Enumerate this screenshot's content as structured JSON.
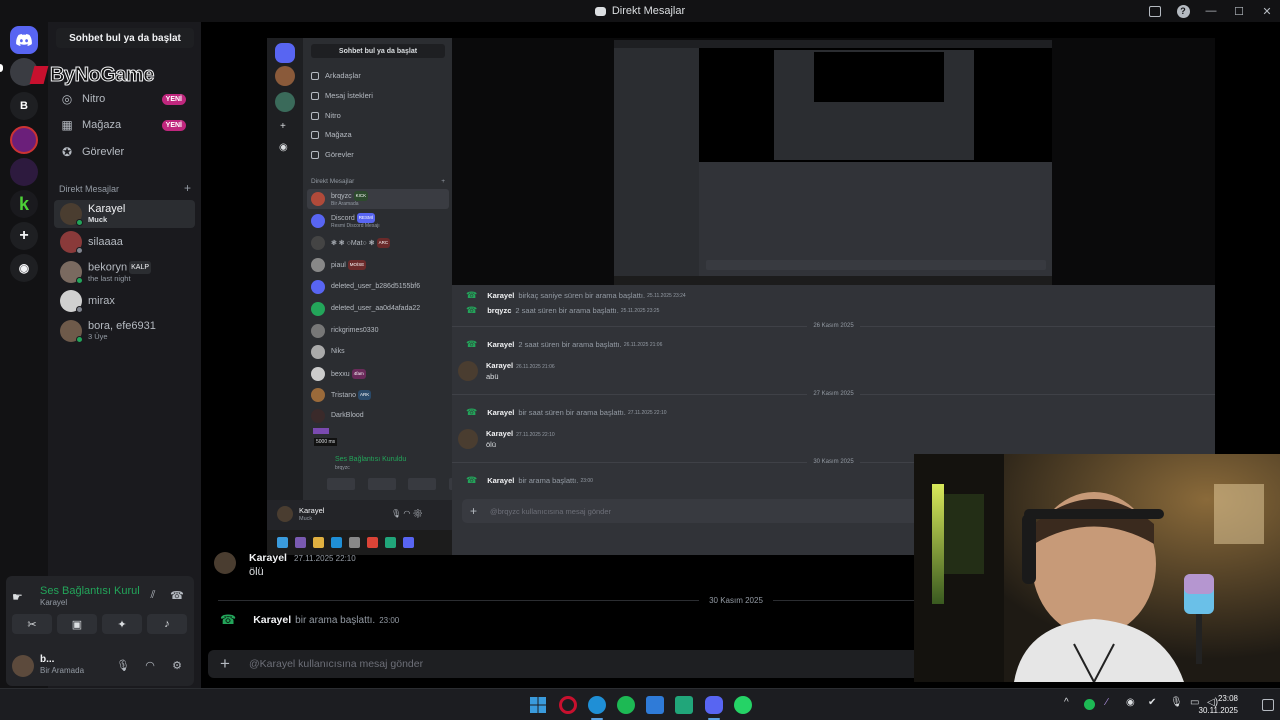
{
  "window": {
    "title": "Direkt Mesajlar"
  },
  "rail": {
    "servers": [
      {
        "name": "discord-home",
        "letter": "",
        "color": "#5865f2"
      },
      {
        "name": "server-b",
        "letter": "B",
        "color": "#2b2d31"
      }
    ]
  },
  "overlay_text": "ByNoGame",
  "sidebar": {
    "search_label": "Sohbet bul ya da başlat",
    "nav": [
      {
        "label": "Nitro",
        "badge": "YENİ"
      },
      {
        "label": "Mağaza",
        "badge": "YENİ"
      },
      {
        "label": "Görevler",
        "badge": ""
      }
    ],
    "dm_header": "Direkt Mesajlar",
    "dm_add": "+",
    "dms": [
      {
        "name": "Karayel",
        "sub": "Muck"
      },
      {
        "name": "silaaaa",
        "sub": ""
      },
      {
        "name": "bekoryn",
        "tag": "KALP",
        "sub": "the last night"
      },
      {
        "name": "mirax",
        "sub": ""
      },
      {
        "name": "bora, efe6931",
        "sub": "3 Üye"
      }
    ]
  },
  "voice": {
    "status": "Ses Bağlantısı Kuruldu",
    "channel": "Karayel",
    "user_name": "b...",
    "user_status": "Bir Aramada"
  },
  "stream": {
    "search_label": "Sohbet bul ya da başlat",
    "nav": [
      "Arkadaşlar",
      "Mesaj İstekleri",
      "Nitro",
      "Mağaza",
      "Görevler"
    ],
    "dm_header": "Direkt Mesajlar",
    "dms": [
      {
        "name": "brqyzc",
        "tag": "KICK",
        "sub": "Bir Aramada"
      },
      {
        "name": "Discord",
        "tag": "RESMİ",
        "sub": "Resmi Discord Mesajı"
      },
      {
        "name": "❃ ❃ ○Mat○ ❃",
        "tag": "ARC",
        "sub": ""
      },
      {
        "name": "piaul",
        "tag": "MOİSE",
        "sub": ""
      },
      {
        "name": "deleted_user_b286d5155bf6",
        "tag": "",
        "sub": ""
      },
      {
        "name": "deleted_user_aa0d4afada22",
        "tag": "",
        "sub": ""
      },
      {
        "name": "rickgrimes0330",
        "tag": "",
        "sub": ""
      },
      {
        "name": "Niks",
        "tag": "",
        "sub": ""
      },
      {
        "name": "bexxu",
        "tag": "4fam",
        "sub": ""
      },
      {
        "name": "Tristano",
        "tag": "ARK",
        "sub": ""
      },
      {
        "name": "DarkBlood",
        "tag": "",
        "sub": ""
      }
    ],
    "ping": "5000 ms",
    "voice_status": "Ses Bağlantısı Kuruldu",
    "voice_sub": "brqyzc",
    "user_name": "Karayel",
    "user_sub": "Muck",
    "messages": [
      {
        "author": "Karayel",
        "text": "birkaç saniye süren bir arama başlattı.",
        "time": "25.11.2025 23:24"
      },
      {
        "author": "brqyzc",
        "text": "2 saat süren bir arama başlattı.",
        "time": "25.11.2025 23:25"
      },
      {
        "date": "26 Kasım 2025"
      },
      {
        "author": "Karayel",
        "text": "2 saat süren bir arama başlattı.",
        "time": "26.11.2025 21:06"
      },
      {
        "author": "Karayel",
        "avatar": true,
        "text": "abü",
        "time": "26.11.2025 21:06"
      },
      {
        "date": "27 Kasım 2025"
      },
      {
        "author": "Karayel",
        "text": "bir saat süren bir arama başlattı.",
        "time": "27.11.2025 22:10"
      },
      {
        "author": "Karayel",
        "avatar": true,
        "text": "ölü",
        "time": "27.11.2025 22:10"
      },
      {
        "date": "30 Kasım 2025"
      },
      {
        "author": "Karayel",
        "text": "bir arama başlattı.",
        "time": "23:00"
      }
    ],
    "input_placeholder": "@brqyzc kullanıcısına mesaj gönder"
  },
  "chat": {
    "partial_author": "Karayel",
    "partial_time": "27.11.2025 22:10",
    "partial_text": "ölü",
    "date_divider": "30 Kasım 2025",
    "call_author": "Karayel",
    "call_text": "bir arama başlattı.",
    "call_time": "23:00",
    "input_placeholder": "@Karayel kullanıcısına mesaj gönder"
  },
  "taskbar": {
    "apps": [
      {
        "name": "windows-start-icon",
        "color": "#3a9bdc"
      },
      {
        "name": "opera-icon",
        "color": "#c8102e"
      },
      {
        "name": "edge-icon",
        "color": "#1f8fd6"
      },
      {
        "name": "spotify-icon",
        "color": "#1db954"
      },
      {
        "name": "store-icon",
        "color": "#2f7bd8"
      },
      {
        "name": "app-icon",
        "color": "#21a67a"
      },
      {
        "name": "discord-icon",
        "color": "#5865f2"
      },
      {
        "name": "whatsapp-icon",
        "color": "#25d366"
      }
    ],
    "time": "23:08",
    "date": "30.11.2025"
  },
  "colors": {
    "accent": "#5865f2",
    "online": "#23a55a",
    "badge_new": "#c0277e"
  }
}
